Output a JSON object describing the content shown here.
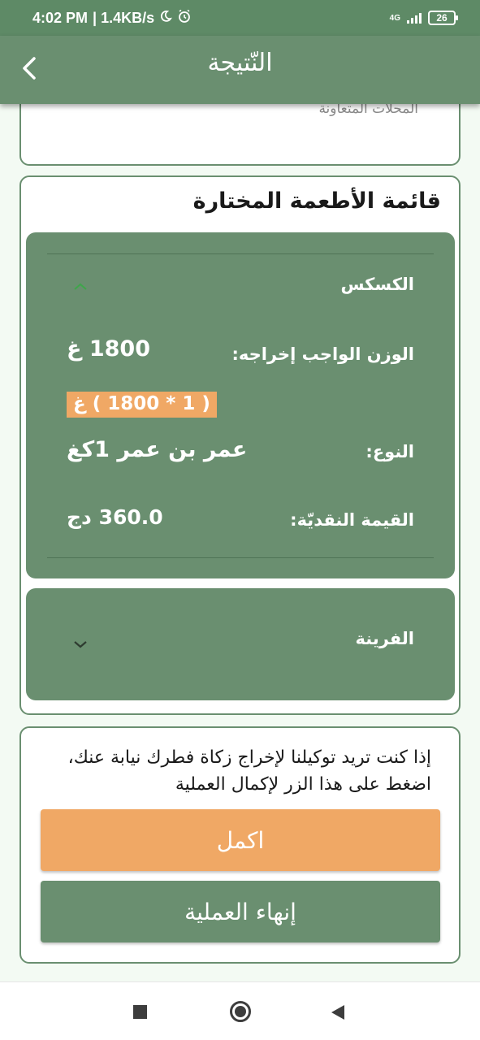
{
  "status_bar": {
    "time": "4:02 PM",
    "speed": "| 1.4KB/s",
    "network": "4G",
    "battery": "26",
    "icons": [
      "moon-icon",
      "alarm-icon",
      "signal-icon",
      "battery-icon"
    ]
  },
  "app_bar": {
    "title": "النّتيجة",
    "back_icon": "chevron-left-icon"
  },
  "partial_card": {
    "text": "المحلات المتعاونة"
  },
  "foods": {
    "title": "قائمة الأطعمة المختارة",
    "items": [
      {
        "name": "الكسكس",
        "expanded": true,
        "weight_label": "الوزن الواجب إخراجه:",
        "weight_value": "1800 غ",
        "calc": "( 1 * 1800 ) غ",
        "type_label": "النوع:",
        "type_value": "عمر بن عمر 1كغ",
        "value_label": "القيمة النقديّة:",
        "value_value": "360.0 دج"
      },
      {
        "name": "الفرينة",
        "expanded": false
      }
    ]
  },
  "delegate": {
    "text": "إذا كنت تريد توكيلنا لإخراج زكاة فطرك نيابة عنك، اضغط على هذا الزر لإكمال العملية",
    "complete_label": "اكمل",
    "finish_label": "إنهاء العملية"
  },
  "colors": {
    "primary": "#6a8f70",
    "accent": "#f0a865",
    "status_bar": "#5e8a66"
  }
}
